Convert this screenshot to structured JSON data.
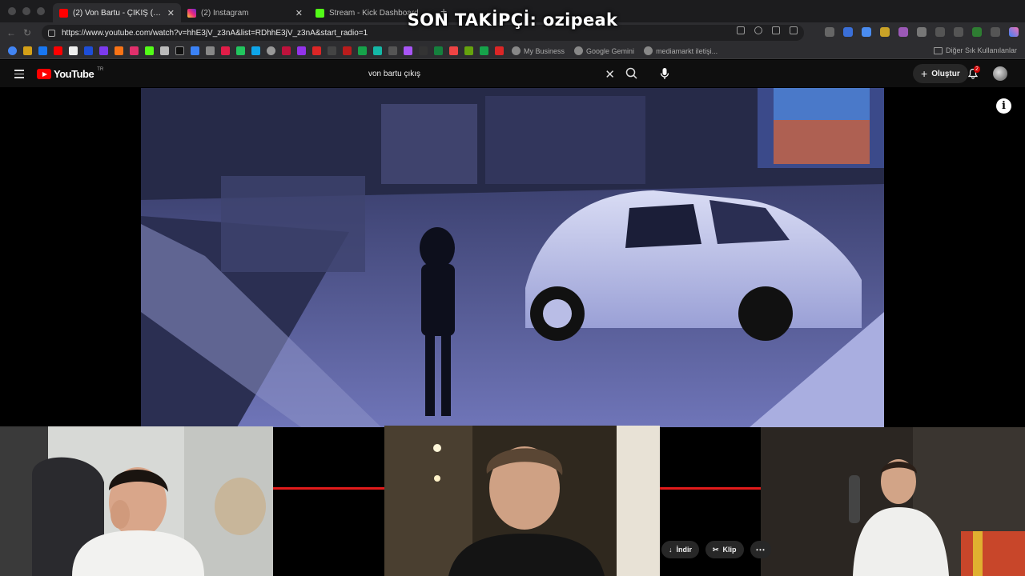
{
  "overlay": {
    "title": "SON TAKİPÇİ: ozipeak"
  },
  "browser": {
    "tabs": [
      {
        "label": "(2) Von Bartu - ÇIKIŞ (Official V",
        "active": true,
        "favicon": "youtube-icon",
        "color": "#ff0000"
      },
      {
        "label": "(2) Instagram",
        "active": false,
        "favicon": "instagram-icon",
        "color": "#d6249f"
      },
      {
        "label": "Stream - Kick Dashboard",
        "active": false,
        "favicon": "kick-icon",
        "color": "#53fc18"
      }
    ],
    "url": "https://www.youtube.com/watch?v=hhE3jV_z3nA&list=RDhhE3jV_z3nA&start_radio=1",
    "bookmarks": {
      "labeled": [
        "My Business",
        "Google Gemini",
        "mediamarkt iletişi..."
      ],
      "other_folder": "Diğer Sık Kullanılanlar"
    }
  },
  "youtube": {
    "logo_text": "YouTube",
    "country": "TR",
    "search_value": "von bartu çıkış",
    "create_label": "Oluştur",
    "notifications_count": "2",
    "actions": {
      "download": "İndir",
      "clip": "Klip",
      "more": "⋯"
    },
    "progress_fraction": 0.96
  },
  "colors": {
    "youtube_red": "#ff0000",
    "progress_red": "#e21b1b",
    "kick_green": "#53fc18"
  }
}
